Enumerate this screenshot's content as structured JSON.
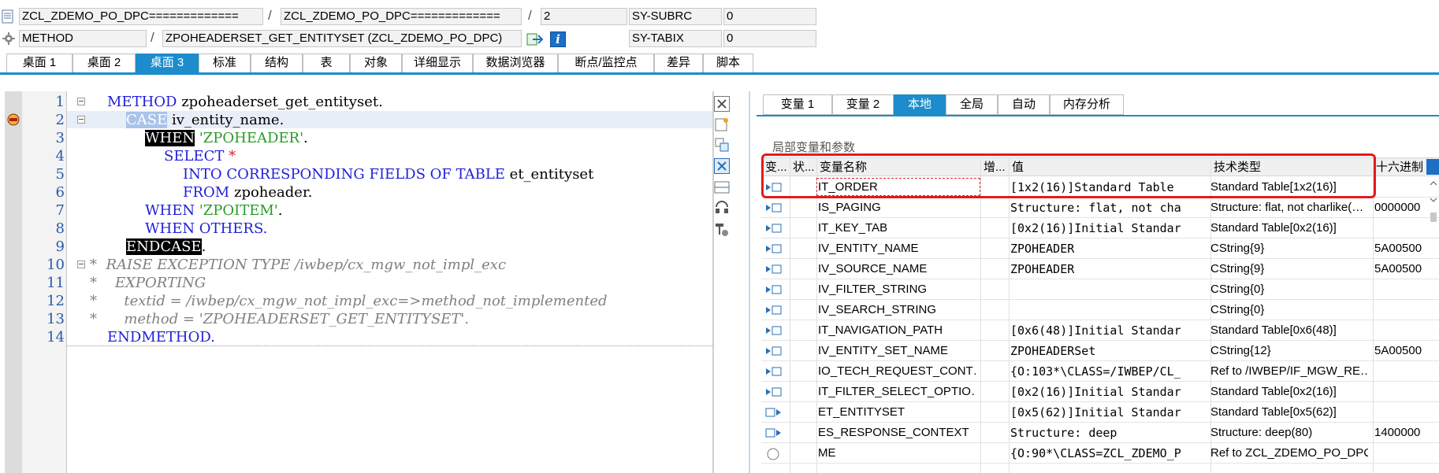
{
  "header": {
    "program_main": "ZCL_ZDEMO_PO_DPC=============",
    "program_include": "ZCL_ZDEMO_PO_DPC=============",
    "line": "2",
    "sy_subrc_label": "SY-SUBRC",
    "sy_subrc_value": "0",
    "event_type": "METHOD",
    "event_name": "ZPOHEADERSET_GET_ENTITYSET (ZCL_ZDEMO_PO_DPC)",
    "sy_tabix_label": "SY-TABIX",
    "sy_tabix_value": "0",
    "separator": "/"
  },
  "tabs": [
    "桌面 1",
    "桌面 2",
    "桌面 3",
    "标准",
    "结构",
    "表",
    "对象",
    "详细显示",
    "数据浏览器",
    "断点/监控点",
    "差异",
    "脚本"
  ],
  "active_tab": 2,
  "code": {
    "line_numbers": [
      "1",
      "2",
      "3",
      "4",
      "5",
      "6",
      "7",
      "8",
      "9",
      "10",
      "11",
      "12",
      "13",
      "14"
    ],
    "l1_kw": "METHOD",
    "l1_rest": " zpoheaderset_get_entityset.",
    "l2_kw": "CASE",
    "l2_rest": " iv_entity_name.",
    "l3_kw": "WHEN",
    "l3_str": " 'ZPOHEADER'",
    "l3_rest": ".",
    "l4_kw": "SELECT",
    "l4_star": " *",
    "l5_kw": "INTO CORRESPONDING FIELDS OF TABLE",
    "l5_rest": " et_entityset",
    "l6_kw": "FROM",
    "l6_rest": " zpoheader.",
    "l7_kw": "WHEN",
    "l7_str": " 'ZPOITEM'",
    "l7_rest": ".",
    "l8_kw": "WHEN OTHERS.",
    "l9_kw": "ENDCASE",
    "l9_rest": ".",
    "l10": "*  RAISE EXCEPTION TYPE /iwbep/cx_mgw_not_impl_exc",
    "l11": "*    EXPORTING",
    "l12": "*      textid = /iwbep/cx_mgw_not_impl_exc=>method_not_implemented",
    "l13": "*      method = 'ZPOHEADERSET_GET_ENTITYSET'.",
    "l14_kw": "ENDMETHOD."
  },
  "var_tabs": [
    "变量 1",
    "变量 2",
    "本地",
    "全局",
    "自动",
    "内存分析"
  ],
  "var_active_tab": 2,
  "grid": {
    "title": "局部变量和参数",
    "columns": [
      "变...",
      "状...",
      "变量名称",
      "增...",
      "值",
      "技术类型",
      "十六进制"
    ],
    "rows": [
      {
        "name": "IT_ORDER",
        "value": "[1x2(16)]Standard Table",
        "type": "Standard Table[1x2(16)]",
        "hex": ""
      },
      {
        "name": "IS_PAGING",
        "value": "Structure: flat, not cha…",
        "type": "Structure: flat, not charlike(…",
        "hex": "0000000"
      },
      {
        "name": "IT_KEY_TAB",
        "value": "[0x2(16)]Initial Standar…",
        "type": "Standard Table[0x2(16)]",
        "hex": ""
      },
      {
        "name": "IV_ENTITY_NAME",
        "value": "ZPOHEADER",
        "type": "CString{9}",
        "hex": "5A00500"
      },
      {
        "name": "IV_SOURCE_NAME",
        "value": "ZPOHEADER",
        "type": "CString{9}",
        "hex": "5A00500"
      },
      {
        "name": "IV_FILTER_STRING",
        "value": "",
        "type": "CString{0}",
        "hex": ""
      },
      {
        "name": "IV_SEARCH_STRING",
        "value": "",
        "type": "CString{0}",
        "hex": ""
      },
      {
        "name": "IT_NAVIGATION_PATH",
        "value": "[0x6(48)]Initial Standar…",
        "type": "Standard Table[0x6(48)]",
        "hex": ""
      },
      {
        "name": "IV_ENTITY_SET_NAME",
        "value": "ZPOHEADERSet",
        "type": "CString{12}",
        "hex": "5A00500"
      },
      {
        "name": "IO_TECH_REQUEST_CONT…",
        "value": "{O:103*\\CLASS=/IWBEP/CL_…",
        "type": "Ref to /IWBEP/IF_MGW_RE…",
        "hex": ""
      },
      {
        "name": "IT_FILTER_SELECT_OPTIO…",
        "value": "[0x2(16)]Initial Standar…",
        "type": "Standard Table[0x2(16)]",
        "hex": ""
      },
      {
        "name": "ET_ENTITYSET",
        "value": "[0x5(62)]Initial Standar…",
        "type": "Standard Table[0x5(62)]",
        "hex": ""
      },
      {
        "name": "ES_RESPONSE_CONTEXT",
        "value": "Structure: deep",
        "type": "Structure: deep(80)",
        "hex": "1400000"
      },
      {
        "name": "ME",
        "value": "{O:90*\\CLASS=ZCL_ZDEMO_P…",
        "type": "Ref to ZCL_ZDEMO_PO_DPC",
        "hex": ""
      }
    ]
  },
  "colors": {
    "accent": "#1c8ccc",
    "highlight_box": "#e31b1b"
  }
}
